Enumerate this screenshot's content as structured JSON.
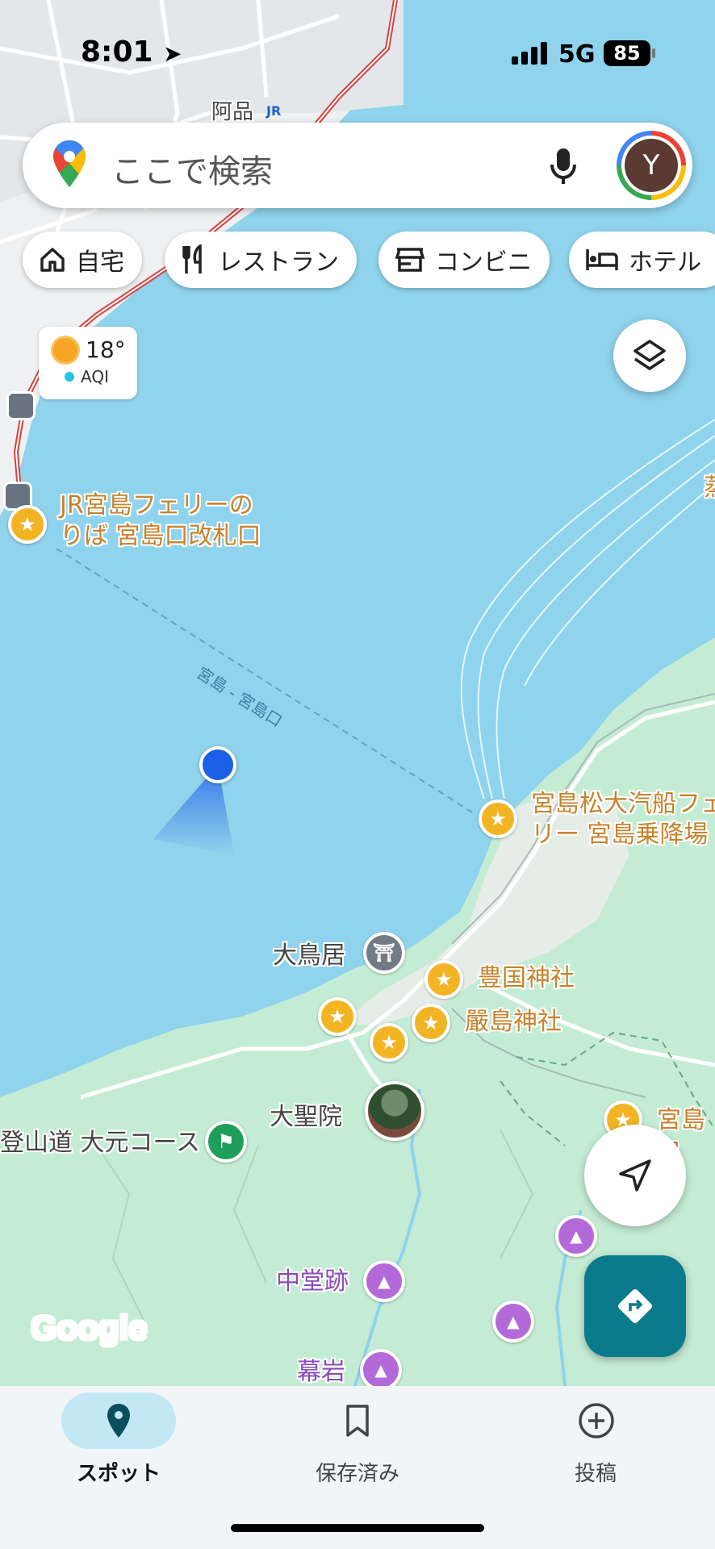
{
  "status_bar": {
    "time": "8:01",
    "network": "5G",
    "battery": "85"
  },
  "search": {
    "placeholder": "ここで検索",
    "avatar_letter": "Y"
  },
  "chips": [
    {
      "label": "自宅",
      "icon": "home-icon"
    },
    {
      "label": "レストラン",
      "icon": "restaurant-icon"
    },
    {
      "label": "コンビニ",
      "icon": "store-icon"
    },
    {
      "label": "ホテル",
      "icon": "hotel-icon"
    }
  ],
  "weather": {
    "temperature": "18°",
    "aqi_label": "AQI"
  },
  "map_labels": {
    "station": "阿品",
    "ferry_route": "宮島 - 宮島口",
    "jr_ferry": "JR宮島フェリーの\nりば 宮島口改札口",
    "matsudai_ferry": "宮島松大汽船フェ\nリー 宮島乗降場",
    "otorii": "大鳥居",
    "toyokuni": "豊国神社",
    "itsukushima": "嚴島神社",
    "daishoin": "大聖院",
    "trail": "登山道 大元コース",
    "miyajima_partial": "宮島ロ",
    "chudoato": "中堂跡",
    "makuiwa": "幕岩",
    "partial_right": "蒸"
  },
  "map_logo": "Google",
  "bottom_nav": [
    {
      "label": "スポット",
      "icon": "location-pin-icon",
      "active": true
    },
    {
      "label": "保存済み",
      "icon": "bookmark-icon",
      "active": false
    },
    {
      "label": "投稿",
      "icon": "add-circle-icon",
      "active": false
    }
  ],
  "colors": {
    "water": "#8fd3ec",
    "land": "#c4ecd4",
    "poi_orange": "#f3b424",
    "poi_purple": "#b36ad8",
    "fab_teal": "#0a7b8c",
    "location_blue": "#1a5fe6"
  }
}
